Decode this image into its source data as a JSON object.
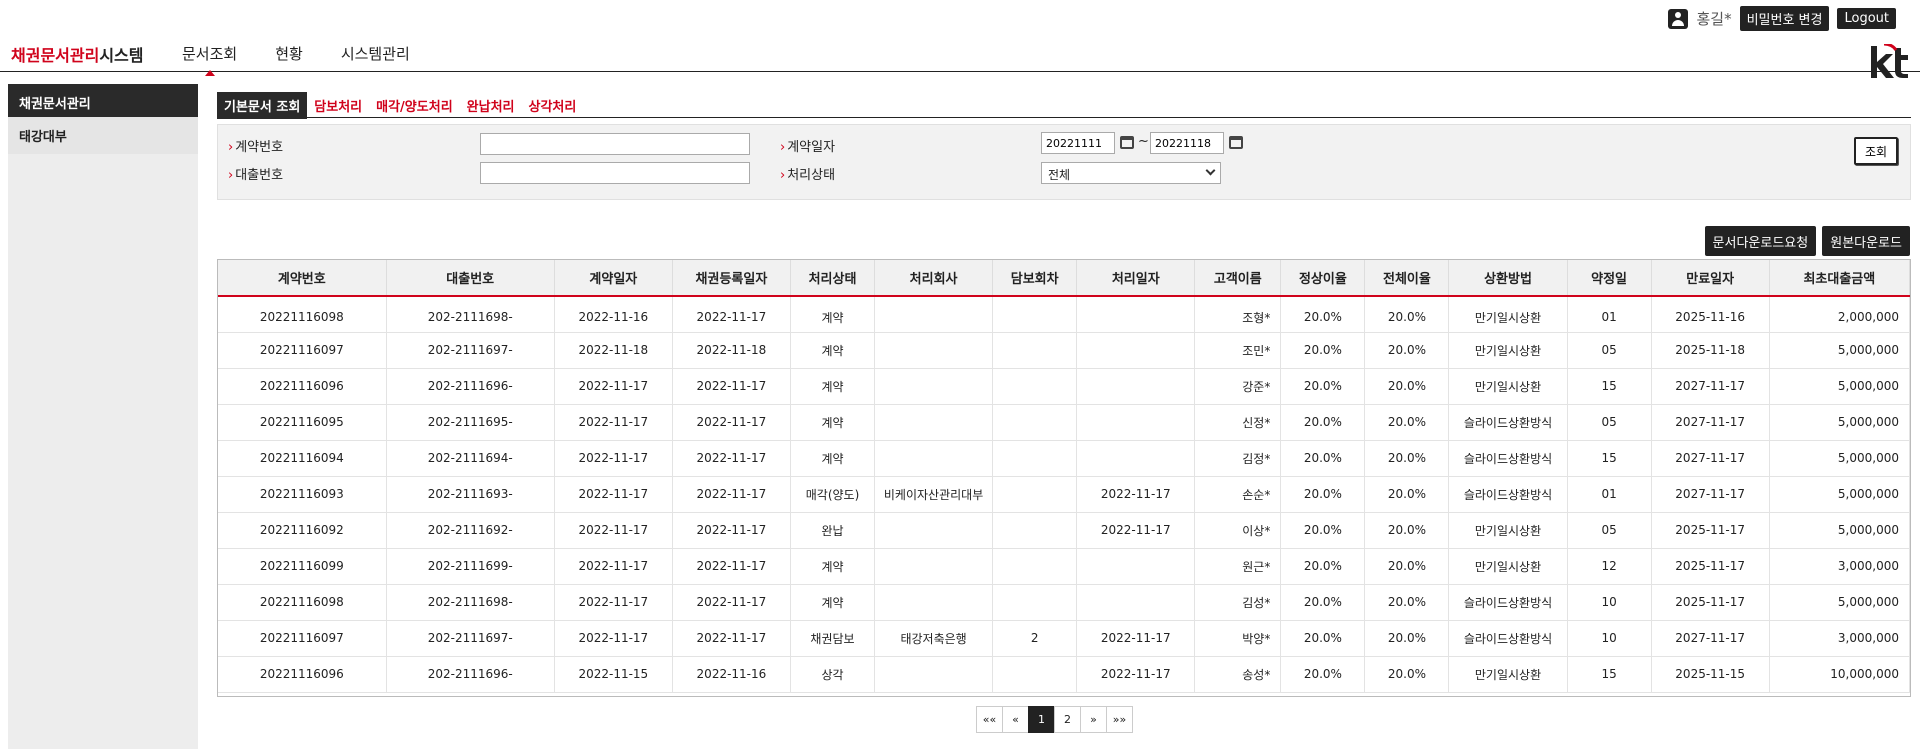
{
  "userbar": {
    "user_name": "홍길*",
    "change_password": "비밀번호 변경",
    "logout": "Logout"
  },
  "header": {
    "logo_red": "채권문서관리",
    "logo_dark": "시스템",
    "menu": [
      "문서조회",
      "현황",
      "시스템관리"
    ],
    "brand": "kt",
    "brand_color": "#d0021b"
  },
  "sidebar": {
    "title": "채권문서관리",
    "items": [
      "태강대부"
    ]
  },
  "tabs": [
    "기본문서 조회",
    "담보처리",
    "매각/양도처리",
    "완납처리",
    "상각처리"
  ],
  "search": {
    "contract_no_label": "계약번호",
    "loan_no_label": "대출번호",
    "contract_date_label": "계약일자",
    "status_label": "처리상태",
    "date_from": "20221111",
    "date_to": "20221118",
    "tilde": "~",
    "status_value": "전체",
    "search_button": "조회"
  },
  "actions": {
    "doc_download_request": "문서다운로드요청",
    "original_download": "원본다운로드"
  },
  "table": {
    "columns": [
      "계약번호",
      "대출번호",
      "계약일자",
      "채권등록일자",
      "처리상태",
      "처리회사",
      "담보회차",
      "처리일자",
      "고객이름",
      "정상이율",
      "전체이율",
      "상환방법",
      "약정일",
      "만료일자",
      "최초대출금액"
    ],
    "rows": [
      [
        "20221116098",
        "202-2111698-",
        "2022-11-16",
        "2022-11-17",
        "계약",
        "",
        "",
        "",
        "조형*",
        "20.0%",
        "20.0%",
        "만기일시상환",
        "01",
        "2025-11-16",
        "2,000,000"
      ],
      [
        "20221116097",
        "202-2111697-",
        "2022-11-18",
        "2022-11-18",
        "계약",
        "",
        "",
        "",
        "조민*",
        "20.0%",
        "20.0%",
        "만기일시상환",
        "05",
        "2025-11-18",
        "5,000,000"
      ],
      [
        "20221116096",
        "202-2111696-",
        "2022-11-17",
        "2022-11-17",
        "계약",
        "",
        "",
        "",
        "강준*",
        "20.0%",
        "20.0%",
        "만기일시상환",
        "15",
        "2027-11-17",
        "5,000,000"
      ],
      [
        "20221116095",
        "202-2111695-",
        "2022-11-17",
        "2022-11-17",
        "계약",
        "",
        "",
        "",
        "신정*",
        "20.0%",
        "20.0%",
        "슬라이드상환방식",
        "05",
        "2027-11-17",
        "5,000,000"
      ],
      [
        "20221116094",
        "202-2111694-",
        "2022-11-17",
        "2022-11-17",
        "계약",
        "",
        "",
        "",
        "김정*",
        "20.0%",
        "20.0%",
        "슬라이드상환방식",
        "15",
        "2027-11-17",
        "5,000,000"
      ],
      [
        "20221116093",
        "202-2111693-",
        "2022-11-17",
        "2022-11-17",
        "매각(양도)",
        "비케이자산관리대부",
        "",
        "2022-11-17",
        "손순*",
        "20.0%",
        "20.0%",
        "슬라이드상환방식",
        "01",
        "2027-11-17",
        "5,000,000"
      ],
      [
        "20221116092",
        "202-2111692-",
        "2022-11-17",
        "2022-11-17",
        "완납",
        "",
        "",
        "2022-11-17",
        "이상*",
        "20.0%",
        "20.0%",
        "만기일시상환",
        "05",
        "2025-11-17",
        "5,000,000"
      ],
      [
        "20221116099",
        "202-2111699-",
        "2022-11-17",
        "2022-11-17",
        "계약",
        "",
        "",
        "",
        "원근*",
        "20.0%",
        "20.0%",
        "만기일시상환",
        "12",
        "2025-11-17",
        "3,000,000"
      ],
      [
        "20221116098",
        "202-2111698-",
        "2022-11-17",
        "2022-11-17",
        "계약",
        "",
        "",
        "",
        "김성*",
        "20.0%",
        "20.0%",
        "슬라이드상환방식",
        "10",
        "2025-11-17",
        "5,000,000"
      ],
      [
        "20221116097",
        "202-2111697-",
        "2022-11-17",
        "2022-11-17",
        "채권담보",
        "태강저축은행",
        "2",
        "2022-11-17",
        "박양*",
        "20.0%",
        "20.0%",
        "슬라이드상환방식",
        "10",
        "2027-11-17",
        "3,000,000"
      ],
      [
        "20221116096",
        "202-2111696-",
        "2022-11-15",
        "2022-11-16",
        "상각",
        "",
        "",
        "2022-11-17",
        "송성*",
        "20.0%",
        "20.0%",
        "만기일시상환",
        "15",
        "2025-11-15",
        "10,000,000"
      ]
    ]
  },
  "pagination": {
    "first": "««",
    "prev": "«",
    "pages": [
      "1",
      "2"
    ],
    "next": "»",
    "last": "»»"
  }
}
